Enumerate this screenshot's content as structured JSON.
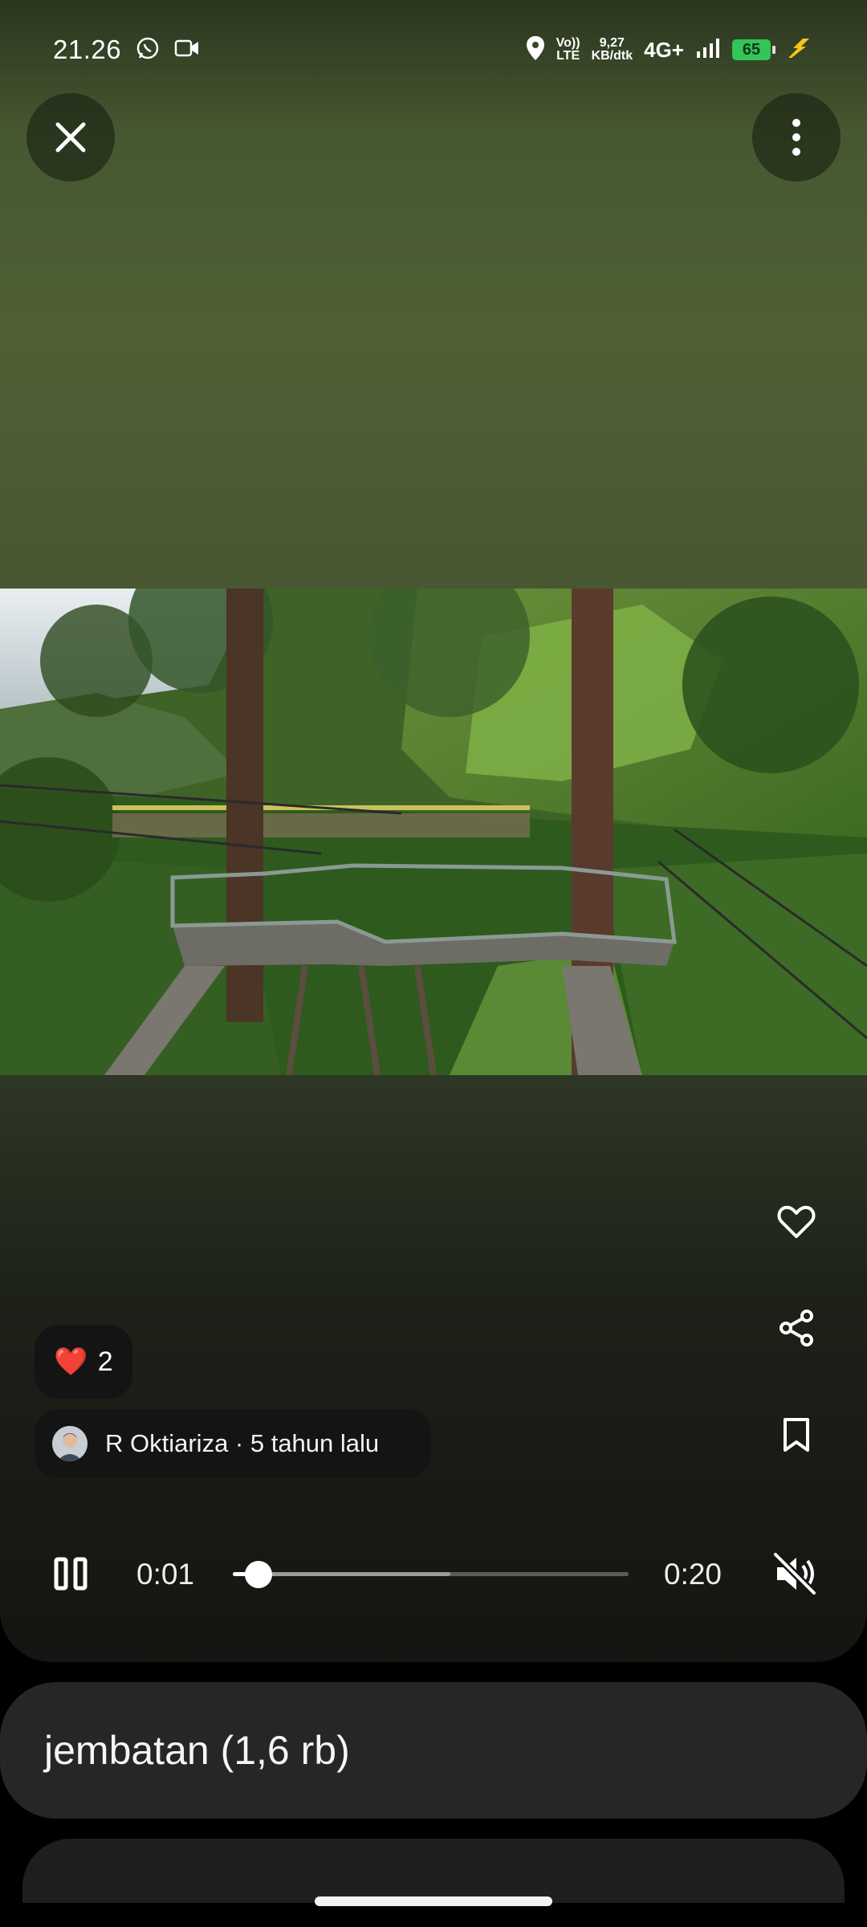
{
  "status_bar": {
    "time": "21.26",
    "volte_label": "Vo))",
    "lte_label": "LTE",
    "speed_value": "9,27",
    "speed_unit": "KB/dtk",
    "network": "4G+",
    "battery": "65",
    "icons": [
      "whatsapp-icon",
      "video-camera-icon",
      "location-icon",
      "signal-icon",
      "battery-icon",
      "charging-icon"
    ]
  },
  "header": {
    "close_icon": "close-icon",
    "menu_icon": "more-vert-icon"
  },
  "media": {
    "description": "photo"
  },
  "likes": {
    "emoji": "❤️",
    "count": "2"
  },
  "author": {
    "text": "R Oktiariza · 5 tahun lalu"
  },
  "actions": [
    "heart-icon",
    "share-icon",
    "bookmark-icon"
  ],
  "player": {
    "state": "playing",
    "current_time": "0:01",
    "duration": "0:20",
    "progress": 0.065,
    "buffered": 0.55,
    "muted": true
  },
  "search_card": {
    "label": "jembatan (1,6 rb)"
  }
}
